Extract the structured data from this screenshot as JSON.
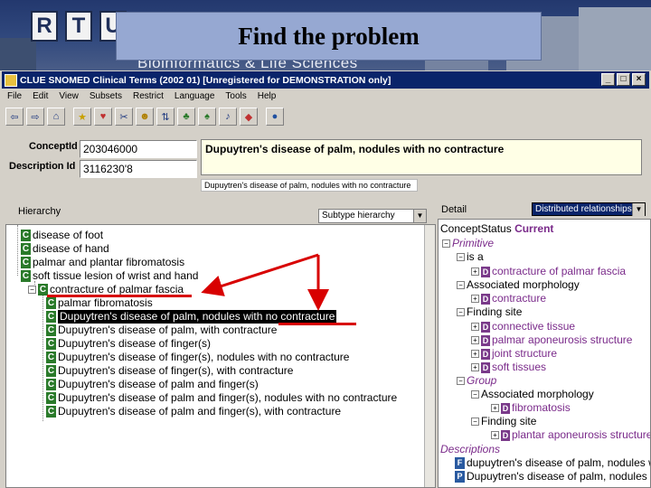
{
  "banner": {
    "logo_letters": [
      "R",
      "T",
      "U"
    ],
    "slide_title": "Find the problem",
    "subtitle": "Bioinformatics & Life Sciences"
  },
  "window": {
    "title": "CLUE   SNOMED Clinical Terms (2002 01) [Unregistered   for DEMONSTRATION only]",
    "minimize": "_",
    "maximize": "□",
    "close": "×"
  },
  "menu": [
    "File",
    "Edit",
    "View",
    "Subsets",
    "Restrict",
    "Language",
    "Tools",
    "Help"
  ],
  "toolbar_icons": [
    "back-icon",
    "forward-icon",
    "home-icon",
    "star-icon",
    "favorites-icon",
    "scissors-icon",
    "person-icon",
    "sort-icon",
    "plant-icon",
    "tree-icon",
    "music-icon",
    "kite-icon",
    "globe-icon"
  ],
  "concept": {
    "concept_id_label": "ConceptId",
    "concept_id_value": "203046000",
    "description_id_label": "Description Id",
    "description_id_value": "3116230'8",
    "description": "Dupuytren's disease of palm, nodules with no contracture",
    "description_small": "Dupuytren's disease of palm, nodules with no contracture"
  },
  "hierarchy": {
    "label": "Hierarchy",
    "select_value": "Subtype hierarchy",
    "items": [
      "disease of foot",
      "disease of hand",
      "palmar and plantar fibromatosis",
      "soft tissue lesion of wrist and hand",
      "contracture of palmar fascia",
      "palmar fibromatosis",
      "Dupuytren's disease of palm, nodules with no contracture",
      "Dupuytren's disease of palm, with contracture",
      "Dupuytren's disease of finger(s)",
      "Dupuytren's disease of finger(s), nodules with no contracture",
      "Dupuytren's disease of finger(s), with contracture",
      "Dupuytren's disease of palm and finger(s)",
      "Dupuytren's disease of palm and finger(s), nodules with no contracture",
      "Dupuytren's disease of palm and finger(s), with contracture"
    ]
  },
  "detail": {
    "label": "Detail",
    "select_value": "Distributed relationships",
    "concept_status_label": "ConceptStatus",
    "concept_status_value": "Current",
    "primitive": "Primitive",
    "is_a": "is a",
    "is_a_value": "contracture of palmar fascia",
    "assoc_morph": "Associated morphology",
    "assoc_morph_value": "contracture",
    "finding_site": "Finding site",
    "finding_sites": [
      "connective tissue",
      "palmar aponeurosis structure",
      "joint structure",
      "soft tissues"
    ],
    "group": "Group",
    "group_assoc_morph": "Associated morphology",
    "group_assoc_morph_value": "fibromatosis",
    "group_finding_site": "Finding site",
    "group_finding_site_value": "plantar aponeurosis structure",
    "descriptions_label": "Descriptions",
    "descriptions": [
      "dupuytren's disease of palm, nodules with no contracture",
      "Dupuytren's disease of palm, nodules with no contracture"
    ]
  },
  "colors": {
    "title_bar": "#0a246a",
    "badge_green": "#2a7a2a",
    "annotation_red": "#d80000",
    "detail_purple": "#7a2a8a"
  }
}
